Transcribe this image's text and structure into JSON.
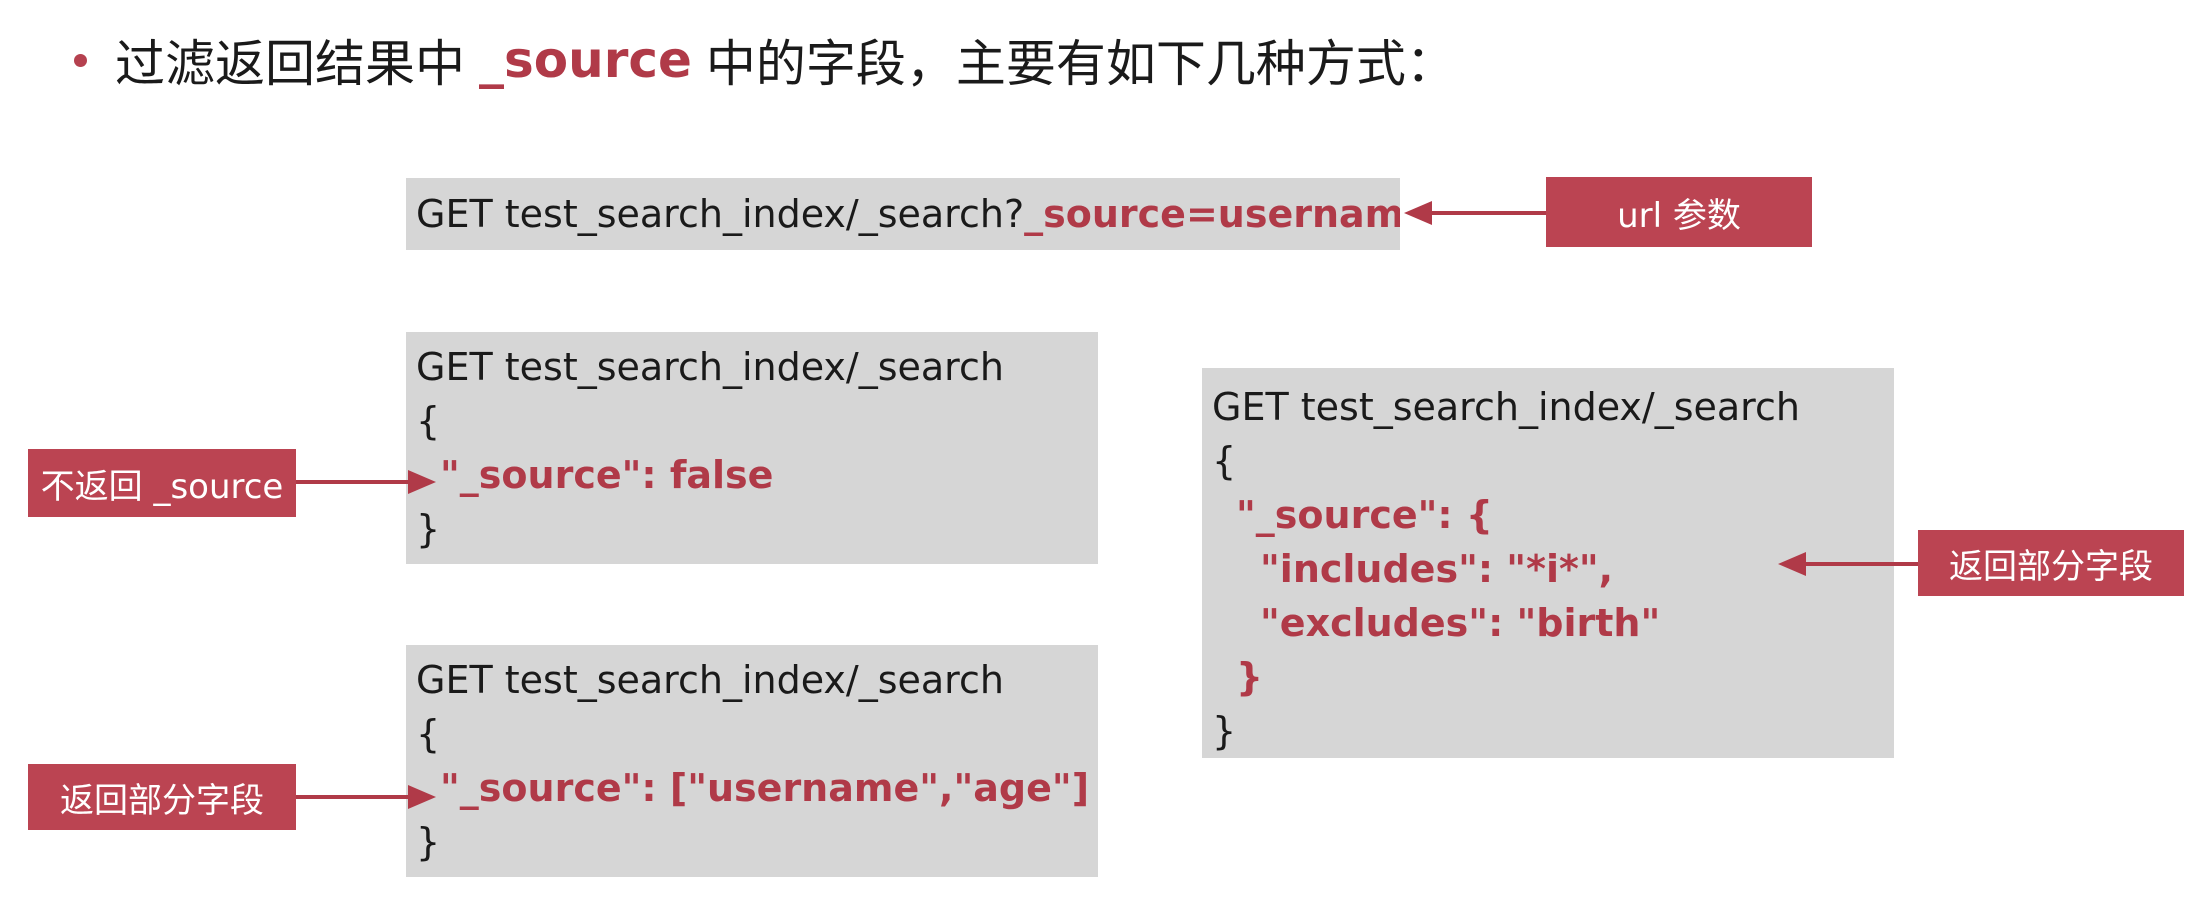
{
  "heading": {
    "text_before": "过滤返回结果中",
    "highlight": "_source",
    "text_after": "中的字段，主要有如下几种方式："
  },
  "box_url": {
    "prefix": "GET test_search_index/_search?",
    "param": "_source=username"
  },
  "box_false": {
    "line1": "GET test_search_index/_search",
    "line2": "{",
    "line3": "\"_source\": false",
    "line4": "}"
  },
  "box_array": {
    "line1": "GET test_search_index/_search",
    "line2": "{",
    "line3": "\"_source\": [\"username\",\"age\"]",
    "line4": "}"
  },
  "box_object": {
    "line1": "GET test_search_index/_search",
    "line2": "{",
    "line3": "\"_source\": {",
    "line4": "\"includes\": \"*i*\",",
    "line5": "\"excludes\": \"birth\"",
    "line6": "}",
    "line7": "}"
  },
  "labels": {
    "url_param": "url 参数",
    "no_source": "不返回 _source",
    "partial_1": "返回部分字段",
    "partial_2": "返回部分字段"
  },
  "colors": {
    "accent": "#b03a48",
    "label_bg": "#bb4452",
    "code_bg": "#d6d6d6"
  }
}
